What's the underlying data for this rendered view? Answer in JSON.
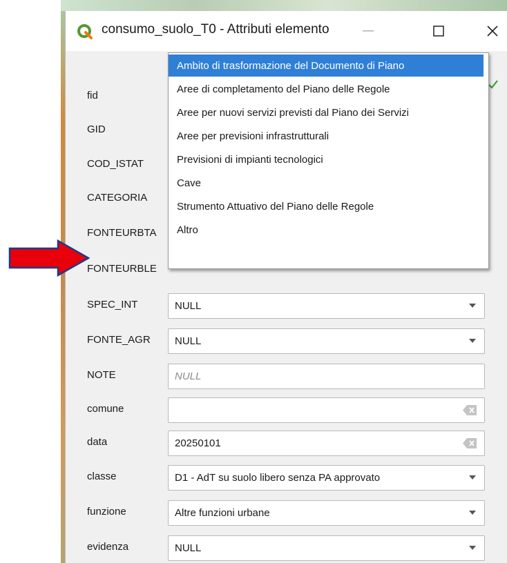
{
  "window": {
    "title": "consumo_suolo_T0 - Attributi elemento",
    "icon": "qgis-logo",
    "minimize_icon": "—",
    "maximize_icon": "☐",
    "close_icon": "✕"
  },
  "fields": [
    {
      "label": "fid"
    },
    {
      "label": "GID"
    },
    {
      "label": "COD_ISTAT"
    },
    {
      "label": "CATEGORIA"
    },
    {
      "label": "FONTEURBTA"
    },
    {
      "label": "FONTEURBLE"
    },
    {
      "label": "SPEC_INT",
      "value": "NULL",
      "widget": "combo"
    },
    {
      "label": "FONTE_AGR",
      "value": "NULL",
      "widget": "combo"
    },
    {
      "label": "NOTE",
      "placeholder": "NULL",
      "widget": "text"
    },
    {
      "label": "comune",
      "value": "",
      "widget": "text-clear"
    },
    {
      "label": "data",
      "value": "20250101",
      "widget": "text-clear"
    },
    {
      "label": "classe",
      "value": "D1 - AdT su suolo libero senza PA approvato",
      "widget": "combo"
    },
    {
      "label": "funzione",
      "value": "Altre funzioni urbane",
      "widget": "combo"
    },
    {
      "label": "evidenza",
      "value": "NULL",
      "widget": "combo"
    }
  ],
  "dropdown": {
    "selected_index": 0,
    "options": [
      "Ambito di trasformazione del Documento di Piano",
      "Aree di completamento del Piano delle Regole",
      "Aree per nuovi servizi previsti dal Piano dei Servizi",
      "Aree per previsioni infrastrutturali",
      "Previsioni di impianti tecnologici",
      "Cave",
      "Strumento Attuativo del Piano delle Regole",
      "Altro"
    ]
  },
  "colors": {
    "selection": "#2f7fd6",
    "annotation_arrow": "#e8000b",
    "valid_check": "#3a9a3a"
  },
  "annotation": {
    "icon": "red-arrow-icon",
    "points_to": "FONTEURBLE"
  }
}
